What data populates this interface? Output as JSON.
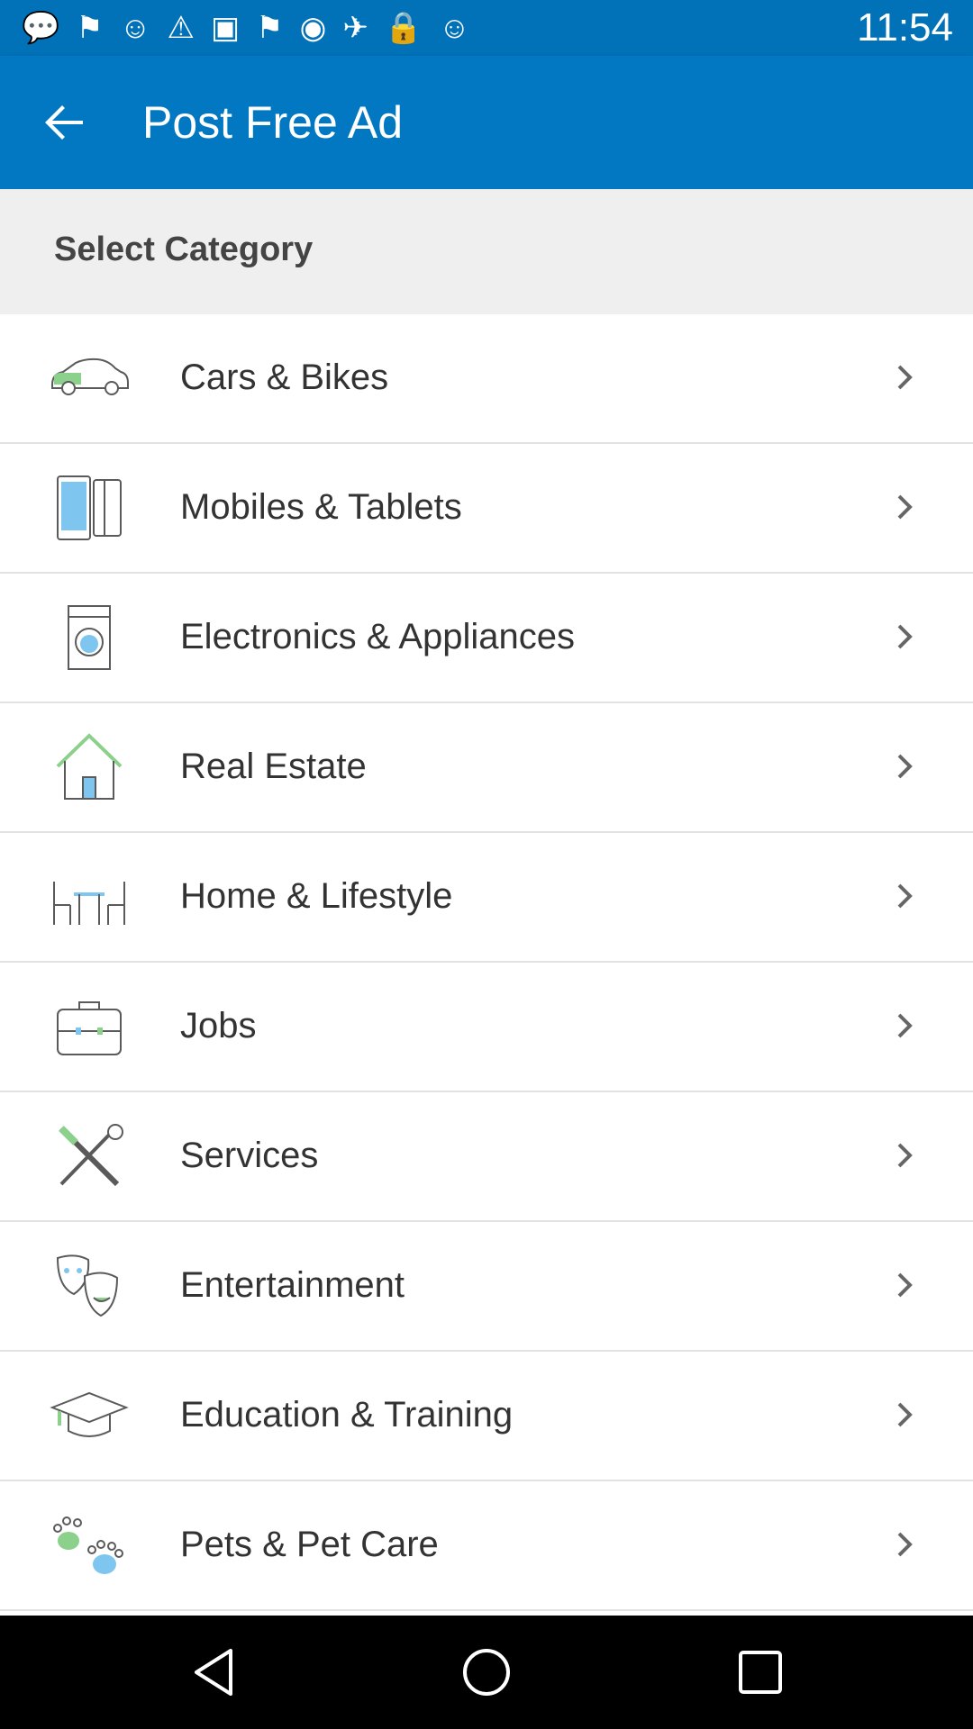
{
  "status_bar": {
    "time": "11:54",
    "icons": [
      "chat-icon",
      "flag-icon",
      "cat-icon",
      "warning-icon",
      "puzzle-icon",
      "flag-icon",
      "target-icon",
      "satellite-icon",
      "lock-icon",
      "cat-icon"
    ],
    "bg_color": "#0171b8"
  },
  "app_bar": {
    "title": "Post Free Ad",
    "back_icon": "arrow-back-icon",
    "bg_color": "#0178c1"
  },
  "section": {
    "title": "Select Category"
  },
  "categories": [
    {
      "label": "Cars & Bikes",
      "icon": "car-icon"
    },
    {
      "label": "Mobiles & Tablets",
      "icon": "mobile-icon"
    },
    {
      "label": "Electronics & Appliances",
      "icon": "washing-machine-icon"
    },
    {
      "label": "Real Estate",
      "icon": "house-icon"
    },
    {
      "label": "Home & Lifestyle",
      "icon": "furniture-icon"
    },
    {
      "label": "Jobs",
      "icon": "briefcase-icon"
    },
    {
      "label": "Services",
      "icon": "tools-icon"
    },
    {
      "label": "Entertainment",
      "icon": "theater-masks-icon"
    },
    {
      "label": "Education & Training",
      "icon": "graduation-cap-icon"
    },
    {
      "label": "Pets & Pet Care",
      "icon": "paw-icon"
    }
  ],
  "nav_bar": {
    "buttons": [
      "back-triangle-icon",
      "home-circle-icon",
      "recents-square-icon"
    ]
  },
  "colors": {
    "icon_green": "#8bd08b",
    "icon_blue": "#7ec6ef",
    "icon_stroke": "#5a5a5a",
    "chevron": "#666666"
  }
}
